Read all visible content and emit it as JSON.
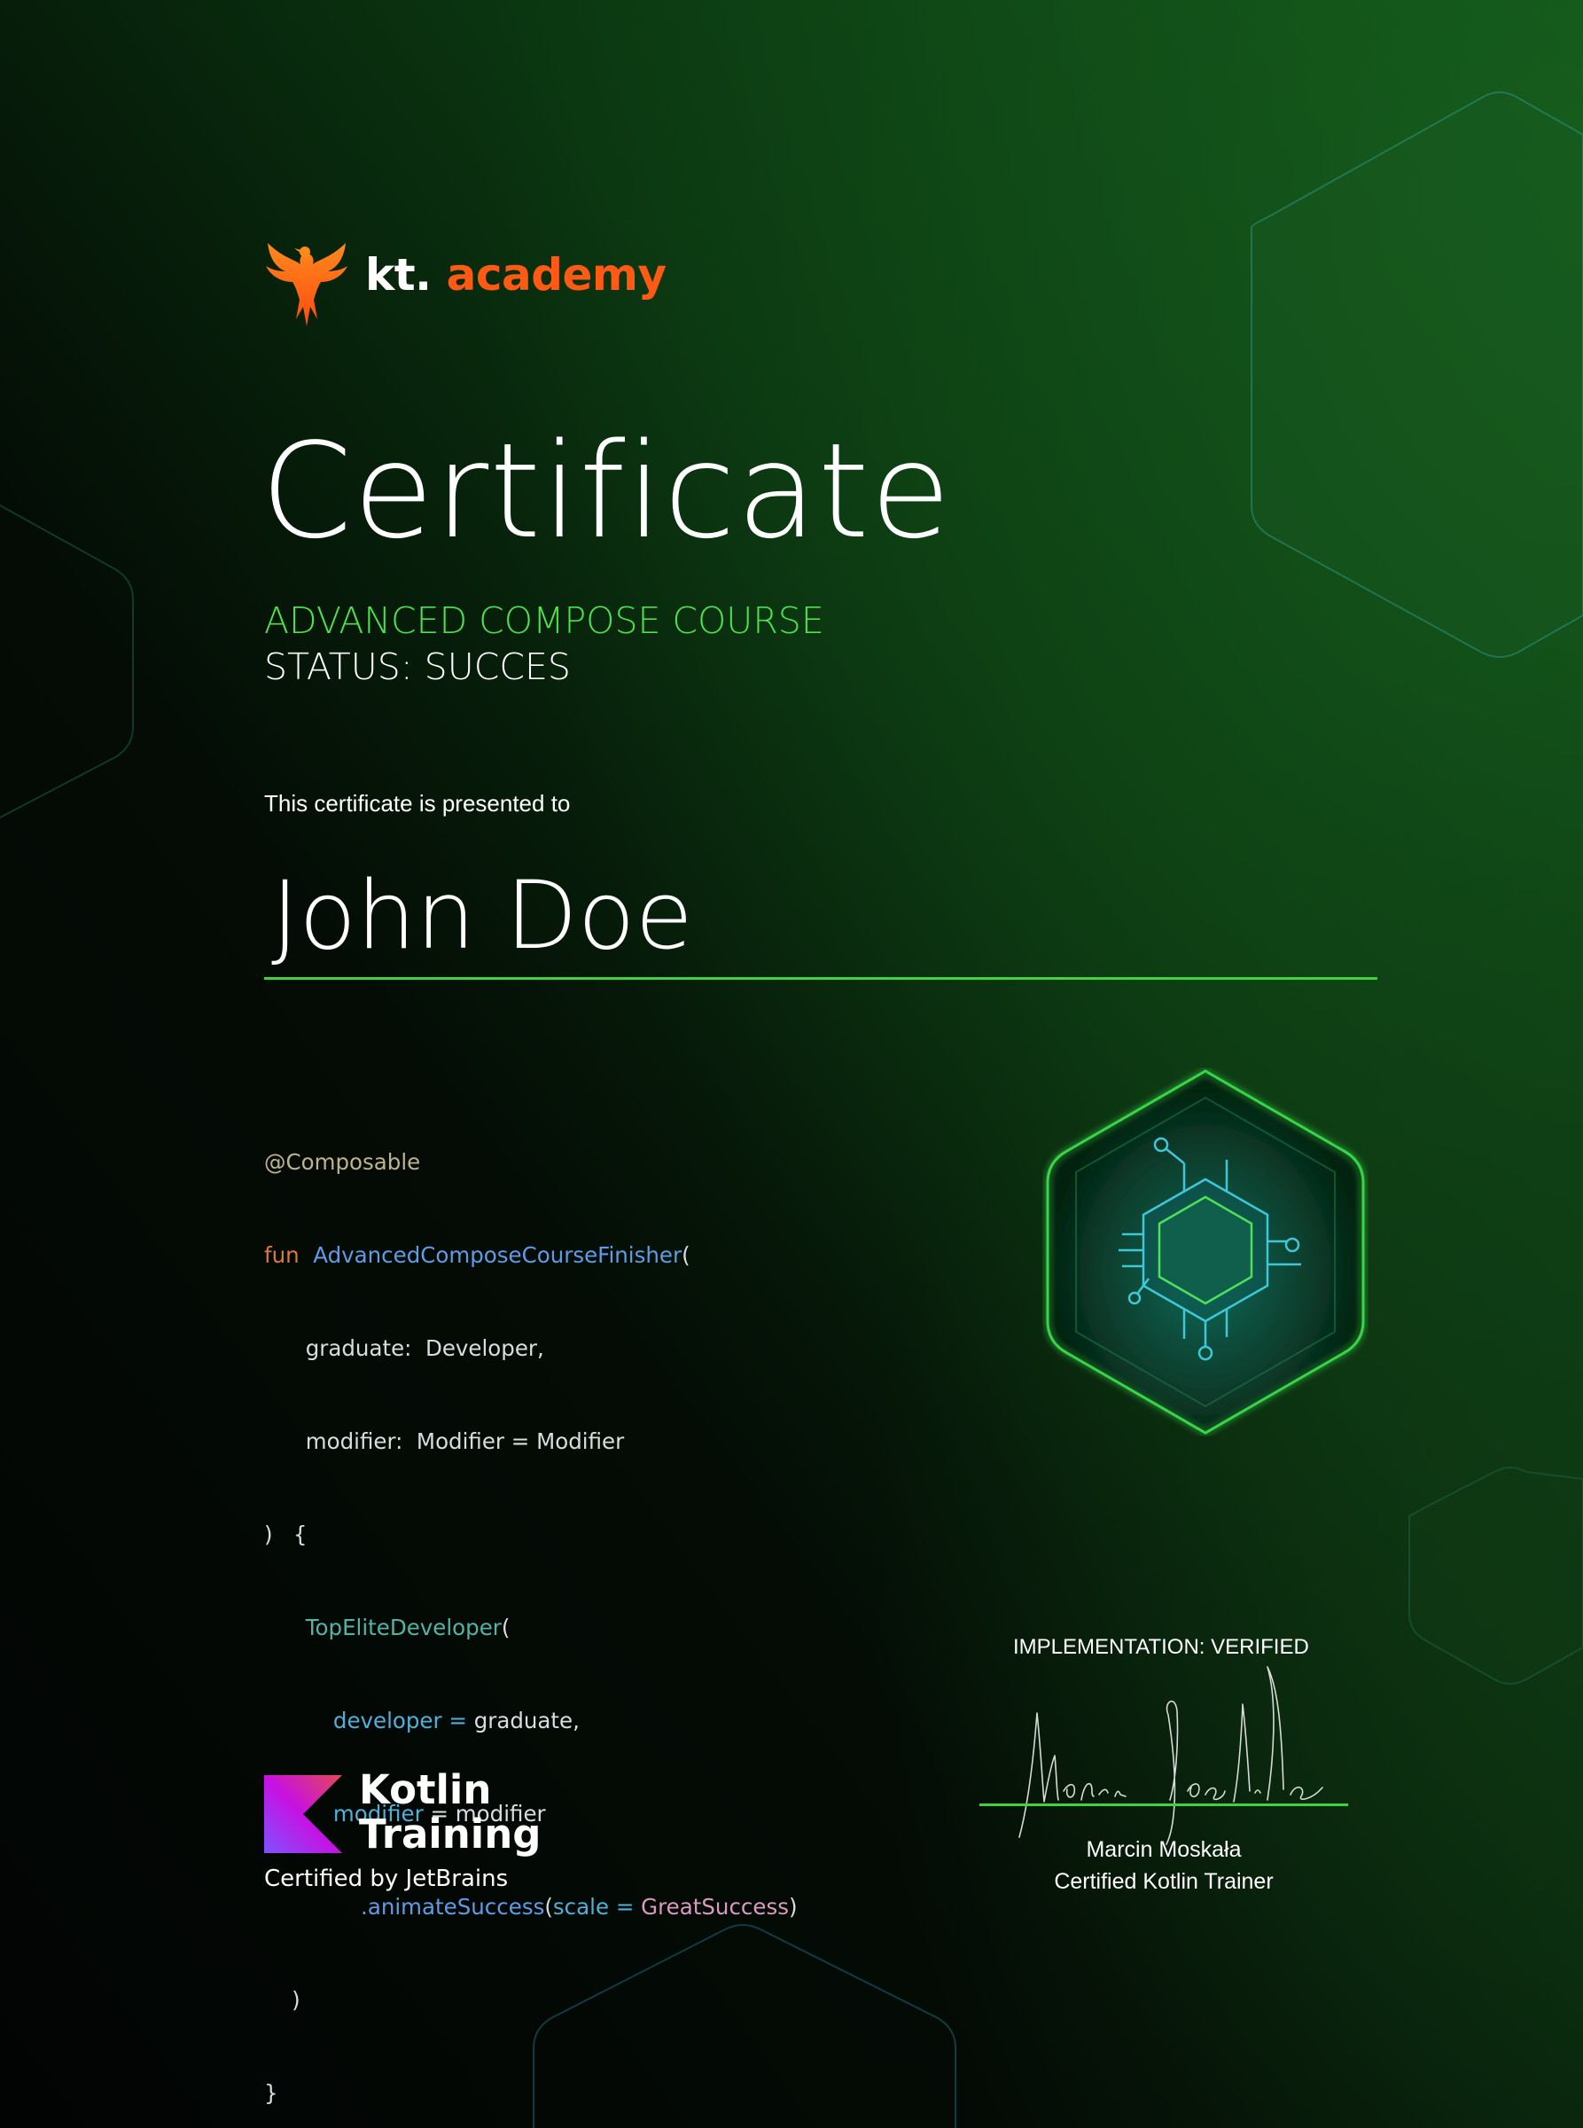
{
  "brand": {
    "logo_icon": "phoenix-icon",
    "prefix": "kt.",
    "name": "academy",
    "accent_color": "#ff5a14"
  },
  "certificate": {
    "title": "Certificate",
    "course": "ADVANCED COMPOSE COURSE",
    "status": "STATUS: SUCCES",
    "presented_to_label": "This certificate is presented to",
    "recipient_name": "John Doe",
    "accent_color": "#3fd43f"
  },
  "code_snippet": {
    "annotation": "@Composable",
    "keyword_fun": "fun",
    "function_name": "AdvancedComposeCourseFinisher",
    "open_paren": "(",
    "param_graduate": "graduate:  Developer,",
    "param_modifier": "modifier:  Modifier = Modifier",
    "close_sig": ")   {",
    "call_name": "TopEliteDeveloper",
    "call_open": "(",
    "arg1_name": "developer =",
    "arg1_value": " graduate,",
    "arg2_name": "modifier",
    "arg2_value": " = modifier",
    "chain_method": ".animateSuccess",
    "chain_open": "(",
    "chain_param": "scale = ",
    "chain_value": "GreatSuccess",
    "chain_close": ")",
    "call_close": ")",
    "body_close": "}"
  },
  "badge": {
    "icon": "chip-hexagon-icon"
  },
  "verification": {
    "label": "IMPLEMENTATION: VERIFIED",
    "signer_name": "Marcin Moskała",
    "signer_role": "Certified Kotlin Trainer",
    "signature_text": "Marcin Moskała"
  },
  "partner": {
    "logo_icon": "kotlin-logo-icon",
    "line1": "Kotlin",
    "line2": "Training",
    "certified_by": "Certified by JetBrains"
  }
}
